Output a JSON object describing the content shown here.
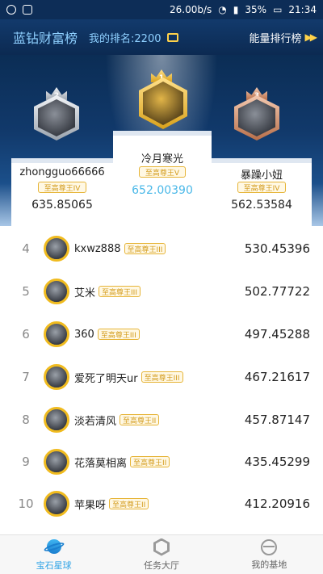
{
  "status_bar": {
    "speed": "26.00b/s",
    "battery": "35%",
    "time": "21:34"
  },
  "header": {
    "title": "蓝钻财富榜",
    "my_rank": "我的排名:2200",
    "energy_link": "能量排行榜"
  },
  "podium": [
    {
      "rank": "1",
      "name": "冷月寒光",
      "tier": "至高尊王V",
      "score": "652.00390",
      "badge": "gold"
    },
    {
      "rank": "2",
      "name": "zhongguo66666",
      "tier": "至高尊王IV",
      "score": "635.85065",
      "badge": "silver"
    },
    {
      "rank": "3",
      "name": "暴躁小妞",
      "tier": "至高尊王IV",
      "score": "562.53584",
      "badge": "bronze"
    }
  ],
  "rows": [
    {
      "rank": "4",
      "name": "kxwz888",
      "tier": "至高尊王III",
      "score": "530.45396"
    },
    {
      "rank": "5",
      "name": "艾米",
      "tier": "至高尊王III",
      "score": "502.77722"
    },
    {
      "rank": "6",
      "name": "360",
      "tier": "至高尊王III",
      "score": "497.45288"
    },
    {
      "rank": "7",
      "name": "爱死了明天ur",
      "tier": "至高尊王III",
      "score": "467.21617"
    },
    {
      "rank": "8",
      "name": "淡若清风",
      "tier": "至高尊王II",
      "score": "457.87147"
    },
    {
      "rank": "9",
      "name": "花落莫相离",
      "tier": "至高尊王II",
      "score": "435.45299"
    },
    {
      "rank": "10",
      "name": "苹果呀",
      "tier": "至高尊王II",
      "score": "412.20916"
    }
  ],
  "tabs": [
    {
      "label": "宝石星球",
      "icon": "planet-icon",
      "active": true
    },
    {
      "label": "任务大厅",
      "icon": "task-hex-icon",
      "active": false
    },
    {
      "label": "我的基地",
      "icon": "base-icon",
      "active": false
    }
  ],
  "colors": {
    "header_bg": "#0d2d57",
    "accent_blue": "#2fa3e6",
    "score_highlight": "#4ab8e8",
    "tier_gold": "#e6b437"
  }
}
